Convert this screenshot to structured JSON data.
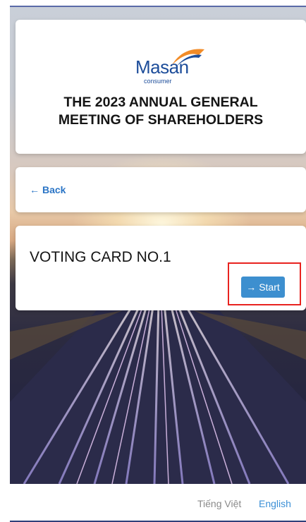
{
  "header": {
    "logo_word": "Masan",
    "logo_sub": "consumer",
    "meeting_title": "THE 2023 ANNUAL GENERAL\nMEETING OF SHAREHOLDERS"
  },
  "nav": {
    "back_label": "Back"
  },
  "voting": {
    "card_title": "VOTING CARD NO.1",
    "start_label": "Start"
  },
  "languages": {
    "vietnamese": "Tiếng Việt",
    "english": "English",
    "active": "English"
  },
  "colors": {
    "brand_blue": "#1d4d9a",
    "link_blue": "#2b75c6",
    "button_blue": "#3d8fcf",
    "logo_orange": "#f28c28",
    "highlight_red": "#e8231f"
  }
}
